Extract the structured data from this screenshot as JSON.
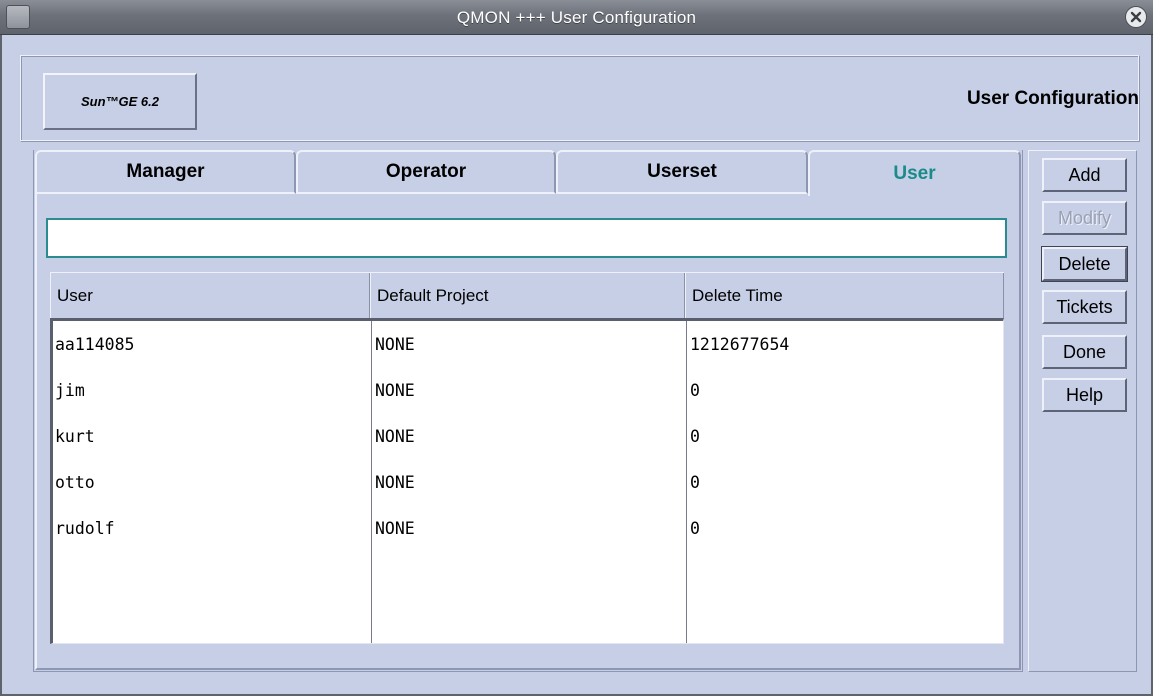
{
  "window": {
    "title": "QMON +++ User Configuration"
  },
  "header": {
    "logo_label": "Sun™GE 6.2",
    "title": "User Configuration"
  },
  "tabs": [
    {
      "label": "Manager",
      "active": false
    },
    {
      "label": "Operator",
      "active": false
    },
    {
      "label": "Userset",
      "active": false
    },
    {
      "label": "User",
      "active": true
    }
  ],
  "filter": {
    "value": "",
    "placeholder": ""
  },
  "table": {
    "columns": [
      "User",
      "Default Project",
      "Delete Time"
    ],
    "rows": [
      [
        "aa114085",
        "NONE",
        "1212677654"
      ],
      [
        "jim",
        "NONE",
        "0"
      ],
      [
        "kurt",
        "NONE",
        "0"
      ],
      [
        "otto",
        "NONE",
        "0"
      ],
      [
        "rudolf",
        "NONE",
        "0"
      ]
    ]
  },
  "buttons": {
    "add": "Add",
    "modify": "Modify",
    "delete": "Delete",
    "tickets": "Tickets",
    "done": "Done",
    "help": "Help"
  },
  "colors": {
    "active_tab": "#1b8a8a",
    "background": "#c6cfe6",
    "input_border": "#2b8c90"
  },
  "icons": {
    "window_menu": "window-menu-icon",
    "close": "close-icon"
  }
}
